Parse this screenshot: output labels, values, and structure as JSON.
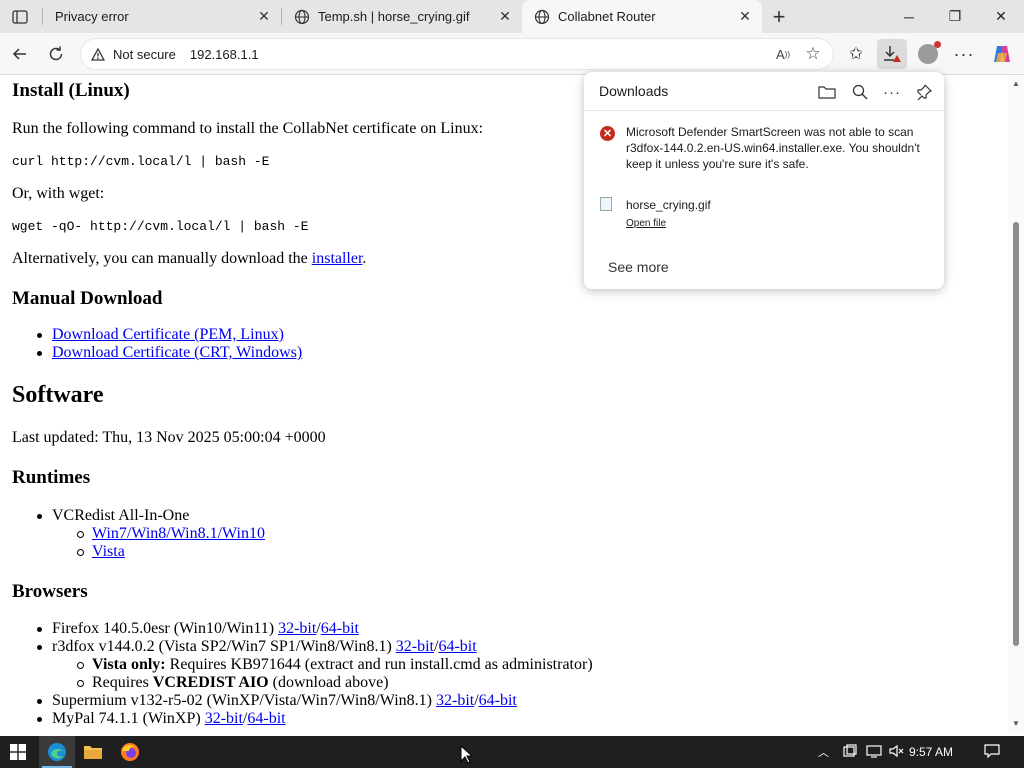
{
  "tabs": [
    {
      "title": "Privacy error",
      "active": false
    },
    {
      "title": "Temp.sh | horse_crying.gif",
      "active": false
    },
    {
      "title": "Collabnet Router",
      "active": true
    }
  ],
  "toolbar": {
    "security_label": "Not secure",
    "url": "192.168.1.1"
  },
  "content": {
    "install_heading": "Install (Linux)",
    "install_intro": "Run the following command to install the CollabNet certificate on Linux:",
    "curl_cmd": "curl http://cvm.local/l | bash -E",
    "wget_intro": "Or, with wget:",
    "wget_cmd": "wget -qO- http://cvm.local/l | bash -E",
    "alt_prefix": "Alternatively, you can manually download the ",
    "alt_link": "installer",
    "alt_suffix": ".",
    "manual_heading": "Manual Download",
    "manual_links": [
      "Download Certificate (PEM, Linux)",
      "Download Certificate (CRT, Windows)"
    ],
    "software_heading": "Software",
    "last_updated": "Last updated: Thu, 13 Nov 2025 05:00:04 +0000",
    "runtimes_heading": "Runtimes",
    "vcredist_label": "VCRedist All-In-One",
    "vcredist_links": [
      "Win7/Win8/Win8.1/Win10",
      "Vista"
    ],
    "browsers_heading": "Browsers",
    "firefox_label": "Firefox 140.5.0esr (Win10/Win11) ",
    "r3dfox_label": "r3dfox v144.0.2 (Vista SP2/Win7 SP1/Win8/Win8.1) ",
    "r3dfox_note1_bold": "Vista only:",
    "r3dfox_note1_text": " Requires KB971644 (extract and run install.cmd as administrator)",
    "r3dfox_note2_prefix": "Requires ",
    "r3dfox_note2_bold": "VCREDIST AIO",
    "r3dfox_note2_suffix": " (download above)",
    "supermium_label": "Supermium v132-r5-02 (WinXP/Vista/Win7/Win8/Win8.1) ",
    "mypal_label": "MyPal 74.1.1 (WinXP) ",
    "link_32": "32-bit",
    "link_64": "64-bit",
    "slash": "/"
  },
  "downloads": {
    "title": "Downloads",
    "warning": "Microsoft Defender SmartScreen was not able to scan r3dfox-144.0.2.en-US.win64.installer.exe. You shouldn't keep it unless you're sure it's safe.",
    "file_name": "horse_crying.gif",
    "open_file": "Open file",
    "see_more": "See more"
  },
  "taskbar": {
    "time": "9:57 AM"
  },
  "colors": {
    "link": "#0000ee",
    "warning_red": "#c42b1c",
    "taskbar": "#1f1f1f"
  }
}
